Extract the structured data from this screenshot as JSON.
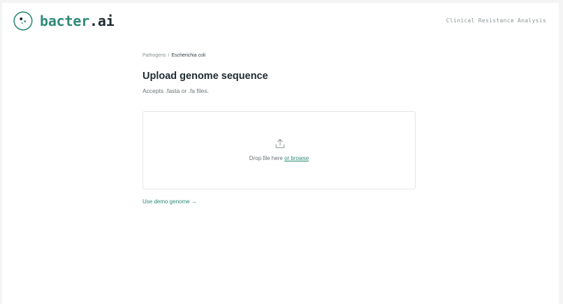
{
  "header": {
    "brand": "bacter",
    "brand_ext": ".ai",
    "logo_icon": "molecule-logo-icon",
    "tagline": "Clinical Resistance Analysis"
  },
  "breadcrumb": {
    "parent": "Pathogens",
    "separator": "/",
    "current": "Escherichia coli"
  },
  "main": {
    "title": "Upload genome sequence",
    "subtitle": "Accepts .fasta or .fa files."
  },
  "dropzone": {
    "icon": "upload-icon",
    "text": "Drop file here",
    "browse_label": "or browse"
  },
  "demo": {
    "label": "Use demo genome →"
  },
  "colors": {
    "accent": "#2f8a78",
    "text": "#1f2a30",
    "muted": "#6a7275",
    "border": "#e3e5e6"
  }
}
